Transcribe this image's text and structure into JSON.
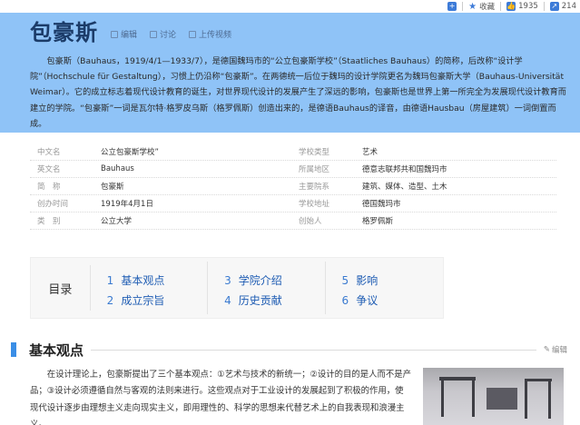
{
  "topbar": {
    "add_icon": "plus-icon",
    "collect_label": "收藏",
    "like_count": "1935",
    "share_count": "214"
  },
  "summary": {
    "title": "包豪斯",
    "actions": [
      "编辑",
      "讨论",
      "上传视频"
    ],
    "paragraph": "包豪斯（Bauhaus，1919/4/1—1933/7），是德国魏玛市的“公立包豪斯学校”（Staatliches Bauhaus）的简称，后改称“设计学院”（Hochschule für Gestaltung），习惯上仍沿称“包豪斯”。在两德统一后位于魏玛的设计学院更名为魏玛包豪斯大学（Bauhaus-Universität Weimar）。它的成立标志着现代设计教育的诞生，对世界现代设计的发展产生了深远的影响，包豪斯也是世界上第一所完全为发展现代设计教育而建立的学院。“包豪斯”一词是瓦尔特·格罗皮乌斯（格罗佩斯）创造出来的，是德语Bauhaus的译音，由德语Hausbau（房屋建筑）一词倒置而成。"
  },
  "infobox": {
    "rows": [
      {
        "k1": "中文名",
        "v1": "公立包豪斯学校”",
        "k2": "学校类型",
        "v2": "艺术"
      },
      {
        "k1": "英文名",
        "v1": "Bauhaus",
        "k2": "所属地区",
        "v2": "德意志联邦共和国魏玛市"
      },
      {
        "k1": "简　称",
        "v1": "包豪斯",
        "k2": "主要院系",
        "v2": "建筑、媒体、造型、土木"
      },
      {
        "k1": "创办时间",
        "v1": "1919年4月1日",
        "k2": "学校地址",
        "v2": "德国魏玛市"
      },
      {
        "k1": "类　别",
        "v1": "公立大学",
        "k2": "创始人",
        "v2": "格罗佩斯"
      }
    ]
  },
  "toc": {
    "label": "目录",
    "items": [
      {
        "num": "1",
        "text": "基本观点"
      },
      {
        "num": "2",
        "text": "成立宗旨"
      },
      {
        "num": "3",
        "text": "学院介绍"
      },
      {
        "num": "4",
        "text": "历史贡献"
      },
      {
        "num": "5",
        "text": "影响"
      },
      {
        "num": "6",
        "text": "争议"
      }
    ]
  },
  "section": {
    "title": "基本观点",
    "edit_label": "编辑",
    "text": "在设计理论上，包豪斯提出了三个基本观点：①艺术与技术的新统一；②设计的目的是人而不是产品；③设计必须遵循自然与客观的法则来进行。这些观点对于工业设计的发展起到了积极的作用，使现代设计逐步由理想主义走向现实主义，即用理性的、科学的思想来代替艺术上的自我表现和浪漫主义。"
  }
}
